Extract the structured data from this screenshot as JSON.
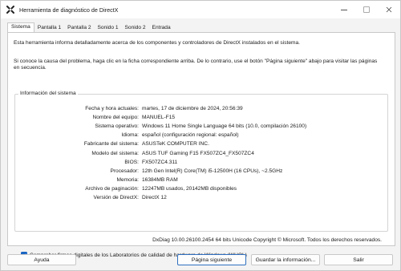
{
  "window": {
    "title": "Herramienta de diagnóstico de DirectX"
  },
  "tabs": [
    {
      "label": "Sistema",
      "active": true
    },
    {
      "label": "Pantalla 1",
      "active": false
    },
    {
      "label": "Pantalla 2",
      "active": false
    },
    {
      "label": "Sonido 1",
      "active": false
    },
    {
      "label": "Sonido 2",
      "active": false
    },
    {
      "label": "Entrada",
      "active": false
    }
  ],
  "intro": {
    "line1": "Esta herramienta informa detalladamente acerca de los componentes y controladores de DirectX instalados en el sistema.",
    "line2": "Si conoce la causa del problema, haga clic en la ficha correspondiente arriba. De lo contrario, use el botón \"Página siguiente\" abajo para visitar las páginas en secuencia."
  },
  "system_info": {
    "legend": "Información del sistema",
    "rows": [
      {
        "label": "Fecha y hora actuales:",
        "value": "martes, 17 de diciembre de 2024, 20:56:39"
      },
      {
        "label": "Nombre del equipo:",
        "value": "MANUEL-F15"
      },
      {
        "label": "Sistema operativo:",
        "value": "Windows 11 Home Single Language 64 bits (10.0, compilación 26100)"
      },
      {
        "label": "Idioma:",
        "value": "español (configuración regional: español)"
      },
      {
        "label": "Fabricante del sistema:",
        "value": "ASUSTeK COMPUTER INC."
      },
      {
        "label": "Modelo del sistema:",
        "value": "ASUS TUF Gaming F15 FX507ZC4_FX507ZC4"
      },
      {
        "label": "BIOS:",
        "value": "FX507ZC4.311"
      },
      {
        "label": "Procesador:",
        "value": "12th Gen Intel(R) Core(TM) i5-12500H (16 CPUs), ~2.5GHz"
      },
      {
        "label": "Memoria:",
        "value": "16384MB RAM"
      },
      {
        "label": "Archivo de paginación:",
        "value": "12247MB usados, 20142MB disponibles"
      },
      {
        "label": "Versión de DirectX:",
        "value": "DirectX 12"
      }
    ]
  },
  "whql_checkbox": {
    "label": "Comprobar firmas digitales de los Laboratorios de calidad de hardware de Windows (WHQL)",
    "checked": true
  },
  "footer": {
    "text": "DxDiag 10.00.26100.2454 64 bits Unicode  Copyright © Microsoft. Todos los derechos reservados."
  },
  "buttons": {
    "help": "Ayuda",
    "next_page": "Página siguiente",
    "save_info": "Guardar la información...",
    "exit": "Salir"
  },
  "colors": {
    "accent": "#1964c2",
    "primary_border": "#2f6fbf"
  },
  "icons": {
    "app": "directx-icon"
  }
}
